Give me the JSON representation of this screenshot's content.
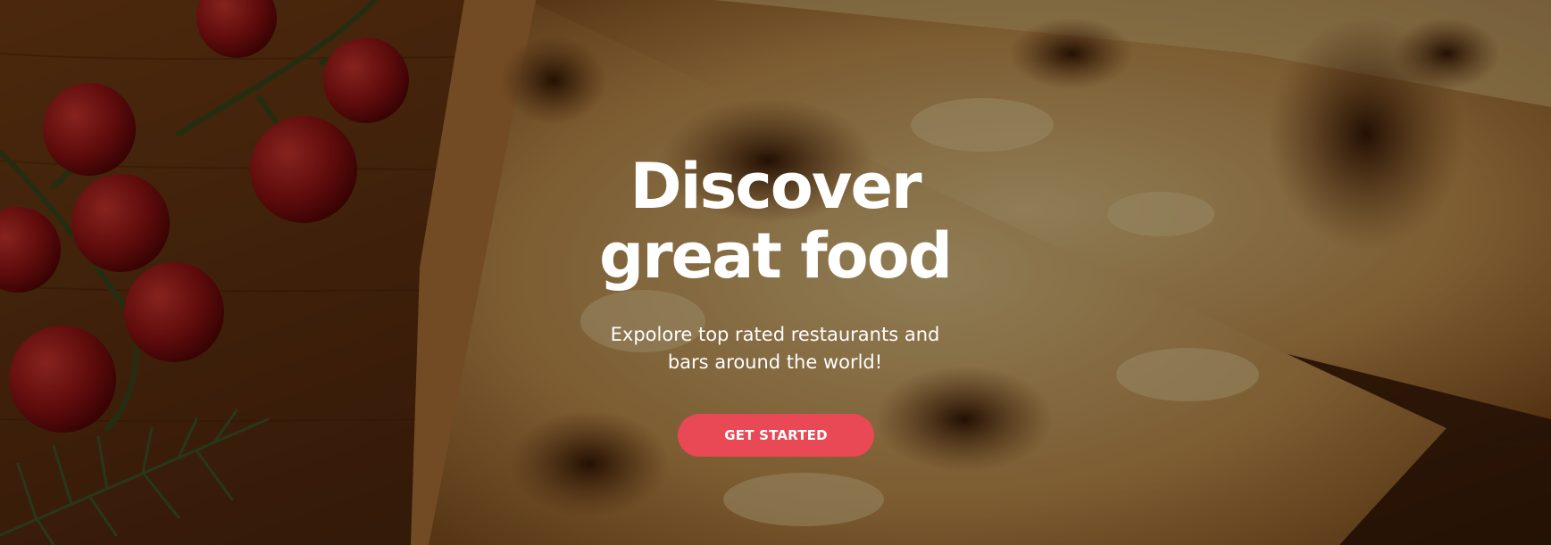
{
  "hero": {
    "title_line1": "Discover",
    "title_line2": "great food",
    "subtitle_line1": "Expolore top rated restaurants and",
    "subtitle_line2": "bars around the world!",
    "cta_label": "GET STARTED"
  },
  "colors": {
    "cta_background": "#e84954",
    "text": "#ffffff",
    "overlay": "rgba(0,0,0,0.38)"
  }
}
